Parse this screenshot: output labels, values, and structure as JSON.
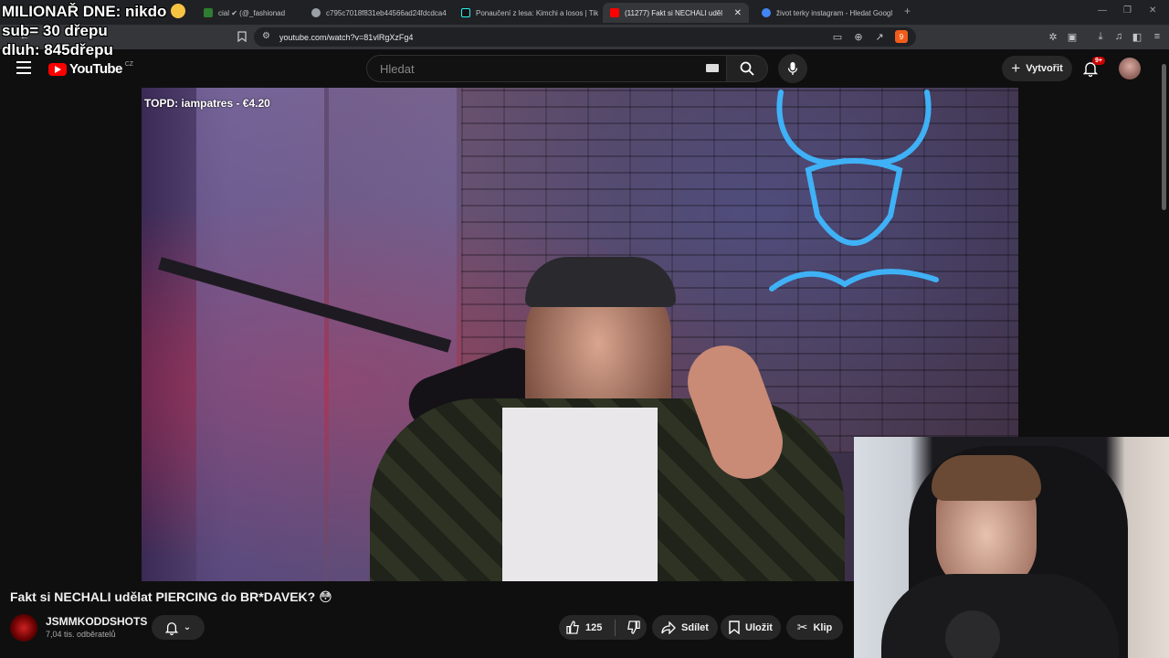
{
  "browser": {
    "tabs": [
      {
        "label": "cial ✔ (@_fashionad",
        "color": "#2e7d32"
      },
      {
        "label": "c795c7018f831eb44566ad24fdcdca4",
        "color": "#9aa0a6"
      },
      {
        "label": "Ponaučení z lesa: Kimchi a losos | Tik",
        "color": "#000000"
      },
      {
        "label": "(11277) Fakt si NECHALI uděl",
        "color": "#ff0000"
      },
      {
        "label": "život terky instagram - Hledat Googl",
        "color": "#4285f4"
      }
    ],
    "url": "youtube.com/watch?v=81vlRgXzFg4",
    "extension_badge": "9"
  },
  "overlay": {
    "line1": "MILIONAŘ DNE: nikdo",
    "line2": "sub= 30 dřepu",
    "line3": "dluh: 845dřepu"
  },
  "youtube": {
    "logo_text": "YouTube",
    "logo_country": "CZ",
    "search_placeholder": "Hledat",
    "create_label": "Vytvořit",
    "notif_badge": "9+",
    "accent": "#ff0000"
  },
  "video": {
    "top_donor": "TOPD: iampatres - €4.20",
    "title": "Fakt si NECHALI udělat PIERCING do BR*DAVEK? 😳",
    "channel": "JSMMKODDSHOTS",
    "subscribers": "7,04 tis. odběratelů",
    "likes": "125",
    "share_label": "Sdílet",
    "save_label": "Uložit",
    "clip_label": "Klip"
  }
}
